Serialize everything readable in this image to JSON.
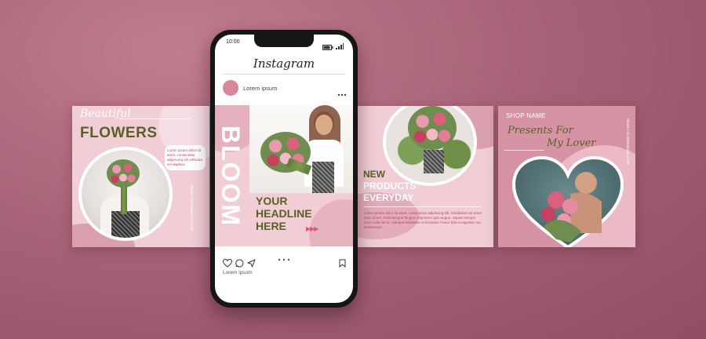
{
  "phone": {
    "time": "10:00",
    "app_title": "Instagram",
    "account_name": "Lorem ipsum",
    "more_icon": "more-horizontal-icon",
    "caption": "Lorem ipsum",
    "actions": [
      "heart-icon",
      "comment-icon",
      "share-icon",
      "bookmark-icon"
    ]
  },
  "post_flowers": {
    "script_title": "Beautiful",
    "title": "FLOWERS",
    "body": "Lorem ipsum dolor sit amet, consectetur adipiscing elit vehicula vel dapibus",
    "side_text": "WWW.YOURWEBSITE.COM"
  },
  "post_bloom": {
    "vertical_word": "BLOOM",
    "headline_lines": [
      "YOUR",
      "HEADLINE",
      "HERE"
    ],
    "arrows": "▶▶▶"
  },
  "post_products": {
    "headline_lines": [
      "NEW",
      "PRODUCTS",
      "EVERYDAY"
    ],
    "body": "Lorem ipsum dolor sit amet, consectetur adipiscing elit. Vestibulum sit amet enim id est. Pellentesque feugiat. Dignissim quis augue. Sapien tempor enim nulla vel et. Volutpat habitasse et tincidunt. Fusce felis et egestas nec scelerisque."
  },
  "post_shop": {
    "shop_name": "SHOP NAME",
    "script_line1": "Presents For",
    "script_line2": "My Lover",
    "side_text": "WWW.YOURWEBSITE.COM"
  },
  "colors": {
    "background": "#a86378",
    "post_pink": "#f1cdd5",
    "accent_pink": "#d79aa9",
    "olive_text": "#5b5f2a"
  }
}
